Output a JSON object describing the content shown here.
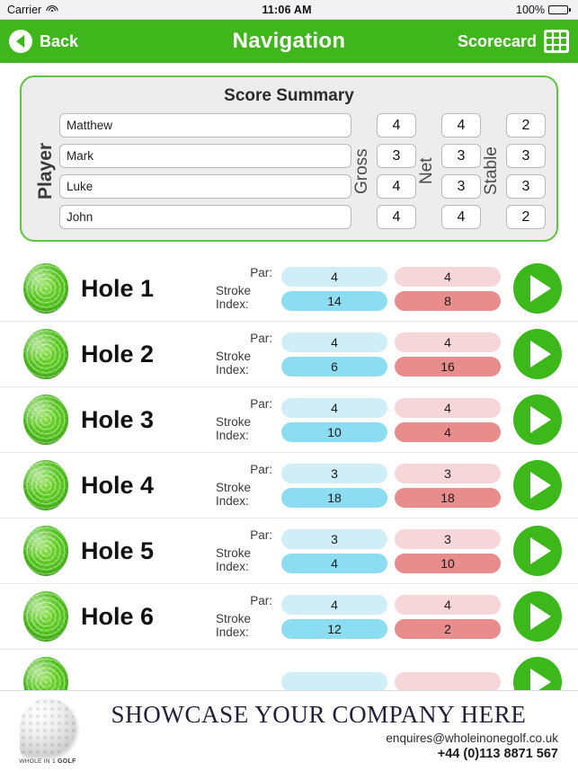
{
  "status_bar": {
    "carrier": "Carrier",
    "wifi_icon": "wifi-icon",
    "time": "11:06 AM",
    "battery_percent": "100%",
    "battery_icon": "battery-full-icon"
  },
  "navbar": {
    "back_icon": "back-circle-arrow-icon",
    "back_label": "Back",
    "title": "Navigation",
    "scorecard_label": "Scorecard",
    "grid_icon": "grid-icon",
    "background_color": "#3fb71c"
  },
  "score_summary": {
    "title": "Score Summary",
    "player_label": "Player",
    "gross_label": "Gross",
    "net_label": "Net",
    "stable_label": "Stable",
    "border_color": "#5cc63c",
    "rows": [
      {
        "player": "Matthew",
        "gross": "4",
        "net": "4",
        "stable": "2"
      },
      {
        "player": "Mark",
        "gross": "3",
        "net": "3",
        "stable": "3"
      },
      {
        "player": "Luke",
        "gross": "4",
        "net": "3",
        "stable": "3"
      },
      {
        "player": "John",
        "gross": "4",
        "net": "4",
        "stable": "2"
      }
    ]
  },
  "holes": {
    "par_label": "Par:",
    "stroke_index_label": "Stroke Index:",
    "ball_icon": "green-golf-ball-icon",
    "play_icon": "play-arrow-icon",
    "colors": {
      "par_blue": "#cfeef7",
      "si_blue": "#8cdcf2",
      "par_pink": "#f7d6d9",
      "si_pink": "#e98c8c",
      "play_green": "#3cb81b"
    },
    "items": [
      {
        "name": "Hole 1",
        "par_blue": "4",
        "par_red": "4",
        "si_blue": "14",
        "si_red": "8"
      },
      {
        "name": "Hole 2",
        "par_blue": "4",
        "par_red": "4",
        "si_blue": "6",
        "si_red": "16"
      },
      {
        "name": "Hole 3",
        "par_blue": "4",
        "par_red": "4",
        "si_blue": "10",
        "si_red": "4"
      },
      {
        "name": "Hole 4",
        "par_blue": "3",
        "par_red": "3",
        "si_blue": "18",
        "si_red": "18"
      },
      {
        "name": "Hole 5",
        "par_blue": "3",
        "par_red": "3",
        "si_blue": "4",
        "si_red": "10"
      },
      {
        "name": "Hole 6",
        "par_blue": "4",
        "par_red": "4",
        "si_blue": "12",
        "si_red": "2"
      }
    ]
  },
  "footer": {
    "logo_icon": "golf-ball-logo-icon",
    "logo_text_prefix": "WHOLE IN 1 ",
    "logo_text_brand": "GOLF",
    "headline": "SHOWCASE YOUR COMPANY HERE",
    "email": "enquires@wholeinonegolf.co.uk",
    "phone": "+44 (0)113 8871 567"
  }
}
